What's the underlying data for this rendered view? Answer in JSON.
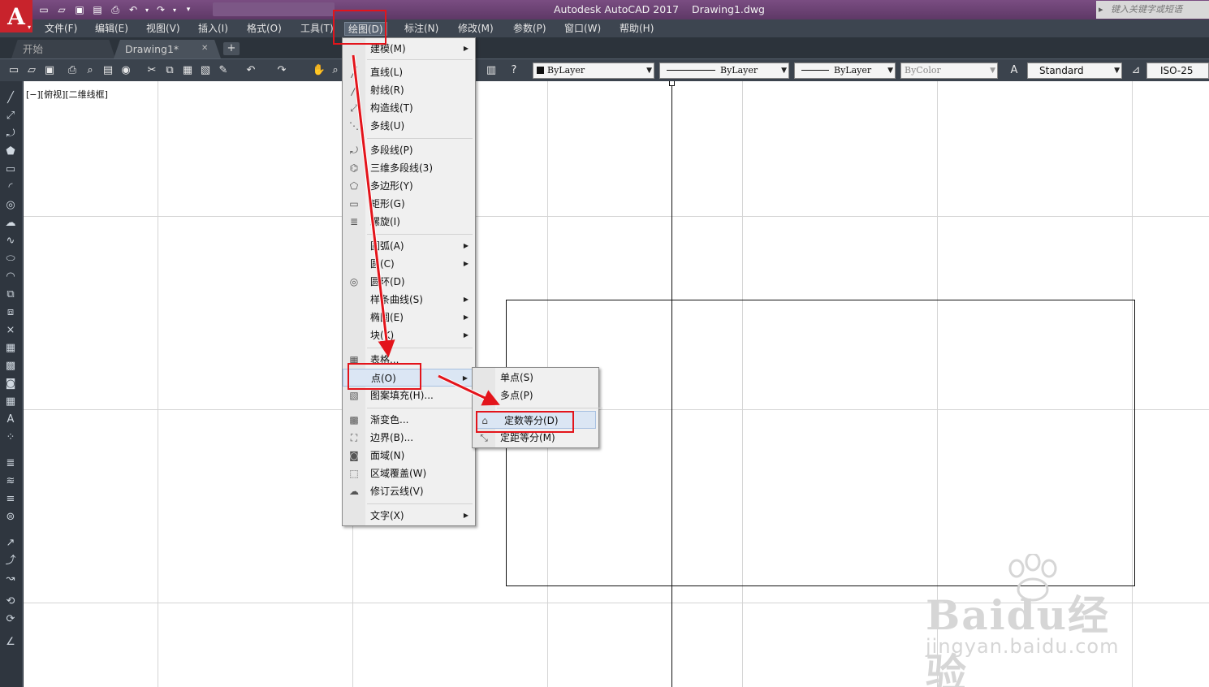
{
  "window": {
    "app_name": "Autodesk AutoCAD 2017",
    "file_name": "Drawing1.dwg",
    "search_placeholder": "键入关键字或短语"
  },
  "logo_letter": "A",
  "menubar": {
    "items": [
      "文件(F)",
      "编辑(E)",
      "视图(V)",
      "插入(I)",
      "格式(O)",
      "工具(T)",
      "绘图(D)",
      "标注(N)",
      "修改(M)",
      "参数(P)",
      "窗口(W)",
      "帮助(H)"
    ],
    "active": "绘图(D)"
  },
  "tabs": {
    "start": "开始",
    "drawing": "Drawing1*",
    "add": "+",
    "close": "✕"
  },
  "properties": {
    "color": "ByLayer",
    "linetype": "ByLayer",
    "lineweight": "ByLayer",
    "plotstyle": "ByColor",
    "text_style": "Standard",
    "dim_style": "ISO-25"
  },
  "viewport_label": "[−][俯视][二维线框]",
  "draw_menu": {
    "items": [
      {
        "label": "建模(M)",
        "submenu": true
      },
      {
        "label": "直线(L)"
      },
      {
        "label": "射线(R)"
      },
      {
        "label": "构造线(T)"
      },
      {
        "label": "多线(U)"
      },
      {
        "label": "多段线(P)"
      },
      {
        "label": "三维多段线(3)"
      },
      {
        "label": "多边形(Y)"
      },
      {
        "label": "矩形(G)"
      },
      {
        "label": "螺旋(I)"
      },
      {
        "label": "圆弧(A)",
        "submenu": true
      },
      {
        "label": "圆(C)",
        "submenu": true
      },
      {
        "label": "圆环(D)"
      },
      {
        "label": "样条曲线(S)",
        "submenu": true
      },
      {
        "label": "椭圆(E)",
        "submenu": true
      },
      {
        "label": "块(K)",
        "submenu": true
      },
      {
        "label": "表格..."
      },
      {
        "label": "点(O)",
        "submenu": true
      },
      {
        "label": "图案填充(H)..."
      },
      {
        "label": "渐变色..."
      },
      {
        "label": "边界(B)..."
      },
      {
        "label": "面域(N)"
      },
      {
        "label": "区域覆盖(W)"
      },
      {
        "label": "修订云线(V)"
      },
      {
        "label": "文字(X)",
        "submenu": true
      }
    ]
  },
  "point_menu": {
    "items": [
      {
        "label": "单点(S)"
      },
      {
        "label": "多点(P)"
      },
      {
        "label": "定数等分(D)"
      },
      {
        "label": "定距等分(M)"
      }
    ]
  },
  "watermark": {
    "logo": "Baidu经验",
    "url": "jingyan.baidu.com"
  },
  "colors": {
    "annotation": "#e3141b",
    "title_bar": "#6b4374",
    "menu_highlight": "#dbe6f4",
    "logo_bg": "#c8232c"
  }
}
